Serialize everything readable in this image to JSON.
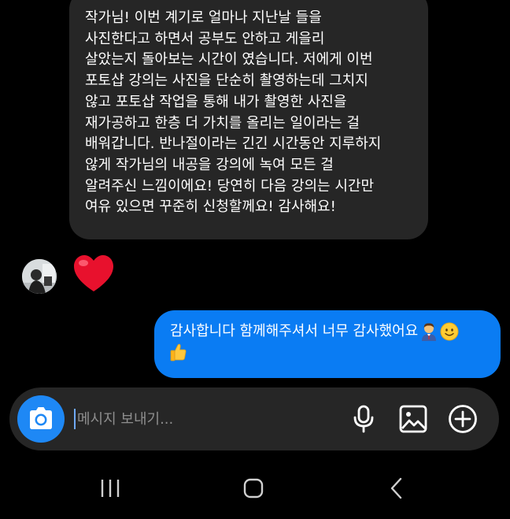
{
  "received_message": {
    "lines": [
      "작가님! 이번 계기로 얼마나 지난날 들을",
      "사진한다고 하면서 공부도 안하고 게을리",
      "살았는지 돌아보는 시간이 였습니다. 저에게 이번",
      "포토샵 강의는 사진을 단순히 촬영하는데 그치지",
      "않고 포토샵 작업을 통해 내가 촬영한 사진을",
      "재가공하고 한층 더 가치를 올리는 일이라는 걸",
      "배워갑니다. 반나절이라는 긴긴 시간동안 지루하지",
      "않게 작가님의 내공을 강의에 녹여 모든 걸",
      "알려주신 느낌이에요! 당연히 다음 강의는 시간만",
      "여유 있으면 꾸준히 신청할께요! 감사해요!"
    ],
    "reaction": "❤️"
  },
  "sent_message": {
    "text": "감사합니다 함께해주셔서 너무 감사했어요",
    "emojis": [
      "👨‍💼",
      "🙂",
      "👍"
    ]
  },
  "composer": {
    "placeholder": "메시지 보내기...",
    "value": ""
  },
  "icons": {
    "camera": "camera-icon",
    "microphone": "microphone-icon",
    "gallery": "image-icon",
    "add": "plus-circle-icon"
  },
  "colors": {
    "background": "#000000",
    "received_bubble": "#262626",
    "sent_bubble": "#0a7cf3",
    "camera_button": "#1e88f5",
    "reaction_heart": "#e8112d"
  }
}
